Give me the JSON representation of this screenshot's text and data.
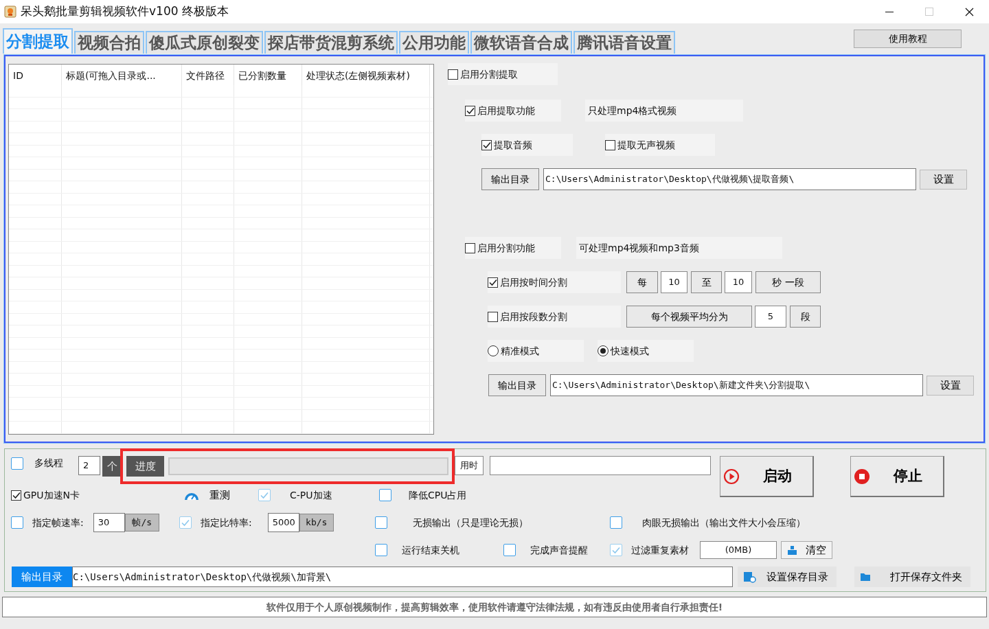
{
  "window": {
    "title": "呆头鹅批量剪辑视频软件v100 终极版本"
  },
  "tabs": [
    {
      "label": "分割提取",
      "selected": true
    },
    {
      "label": "视频合拍",
      "selected": false
    },
    {
      "label": "傻瓜式原创裂变",
      "selected": false
    },
    {
      "label": "探店带货混剪系统",
      "selected": false
    },
    {
      "label": "公用功能",
      "selected": false
    },
    {
      "label": "微软语音合成",
      "selected": false
    },
    {
      "label": "腾讯语音设置",
      "selected": false
    }
  ],
  "help_button": "使用教程",
  "table": {
    "columns": [
      "ID",
      "标题(可拖入目录或...",
      "文件路径",
      "已分割数量",
      "处理状态(左侧视频素材)"
    ]
  },
  "split_extract": {
    "master": {
      "kind": "checkbox",
      "label": "启用分割提取",
      "checked": false
    },
    "extract": {
      "toggle": {
        "kind": "checkbox",
        "label": "启用提取功能",
        "checked": true
      },
      "note": "只处理mp4格式视频",
      "options": [
        {
          "kind": "checkbox",
          "label": "提取音频",
          "checked": true
        },
        {
          "kind": "checkbox",
          "label": "提取无声视频",
          "checked": false
        }
      ],
      "output": {
        "button": "输出目录",
        "path": "C:\\Users\\Administrator\\Desktop\\代做视频\\提取音频\\",
        "set_button": "设置"
      }
    },
    "split": {
      "toggle": {
        "kind": "checkbox",
        "label": "启用分割功能",
        "checked": false
      },
      "note": "可处理mp4视频和mp3音频",
      "by_time": {
        "kind": "checkbox",
        "label": "启用按时间分割",
        "checked": true,
        "every": "每",
        "from": "10",
        "to_label": "至",
        "to": "10",
        "unit": "秒 一段"
      },
      "by_count": {
        "kind": "checkbox",
        "label": "启用按段数分割",
        "checked": false,
        "prefix": "每个视频平均分为",
        "count": "5",
        "unit": "段"
      },
      "modes": [
        {
          "kind": "radio",
          "label": "精准模式",
          "selected": false
        },
        {
          "kind": "radio",
          "label": "快速模式",
          "selected": true
        }
      ],
      "output": {
        "button": "输出目录",
        "path": "C:\\Users\\Administrator\\Desktop\\新建文件夹\\分割提取\\",
        "set_button": "设置"
      }
    }
  },
  "bottom": {
    "multithread": {
      "kind": "flat",
      "label": "多线程",
      "checked": false,
      "count": "2",
      "unit": "个"
    },
    "progress": {
      "label": "进度",
      "level": 0,
      "time_label": "用时"
    },
    "start_button": "启动",
    "stop_button": "停止",
    "gpu": {
      "kind": "checkbox",
      "label": "GPU加速N卡",
      "checked": true
    },
    "retest_button": "重测",
    "cpu": {
      "kind": "flat",
      "label": "C-PU加速",
      "checked": true
    },
    "low_cpu": {
      "kind": "flat",
      "label": "降低CPU占用",
      "checked": false
    },
    "fps": {
      "kind": "flat",
      "label": "指定帧速率:",
      "checked": false,
      "value": "30",
      "unit": "帧/s"
    },
    "bitrate": {
      "kind": "flat",
      "label": "指定比特率:",
      "checked": true,
      "value": "5000",
      "unit": "kb/s"
    },
    "lossless": {
      "kind": "flat",
      "label": "无损输出（只是理论无损）",
      "checked": false
    },
    "visual_lossless": {
      "kind": "flat",
      "label": "肉眼无损输出（输出文件大小会压缩）",
      "checked": false
    },
    "shutdown": {
      "kind": "flat",
      "label": "运行结束关机",
      "checked": false
    },
    "sound": {
      "kind": "flat",
      "label": "完成声音提醒",
      "checked": false
    },
    "dedupe": {
      "kind": "flat",
      "label": "过滤重复素材",
      "checked": true,
      "size": "(0MB)",
      "clear_button": "清空"
    },
    "output": {
      "label": "输出目录",
      "path": "C:\\Users\\Administrator\\Desktop\\代做视频\\加背景\\",
      "set_button": "设置保存目录",
      "open_button": "打开保存文件夹"
    }
  },
  "notice": "软件仅用于个人原创视频制作，提高剪辑效率，使用软件请遵守法律法规，如有违反由使用者自行承担责任!"
}
